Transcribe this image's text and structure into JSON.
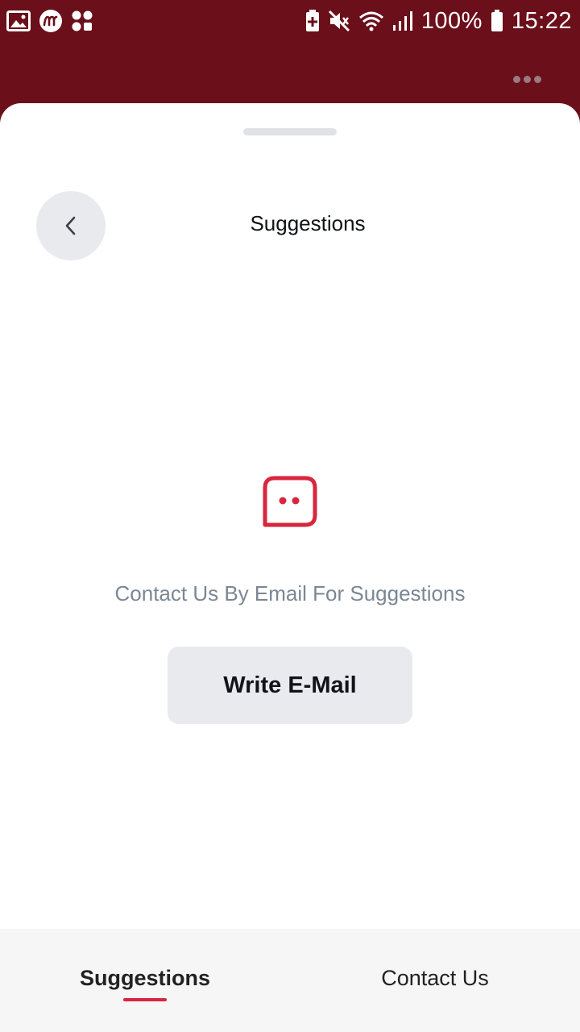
{
  "status_bar": {
    "battery_percent": "100%",
    "time": "15:22",
    "left_icons": [
      "gallery-icon",
      "m-app-icon",
      "apps-icon"
    ],
    "right_icons": [
      "battery-saver-icon",
      "mute-icon",
      "wifi-icon",
      "signal-icon",
      "battery-icon"
    ]
  },
  "header": {
    "more_icon": "more-horizontal-icon"
  },
  "sheet": {
    "title": "Suggestions",
    "back_icon": "chevron-left-icon",
    "empty_icon": "chat-bubble-icon",
    "message": "Contact Us By Email For Suggestions",
    "email_button_label": "Write E-Mail"
  },
  "tabs": [
    {
      "label": "Suggestions",
      "active": true
    },
    {
      "label": "Contact Us",
      "active": false
    }
  ],
  "colors": {
    "header_bg": "#6b0f1a",
    "accent": "#d7263d",
    "muted_text": "#7b8794",
    "button_bg": "#e8eaee"
  }
}
